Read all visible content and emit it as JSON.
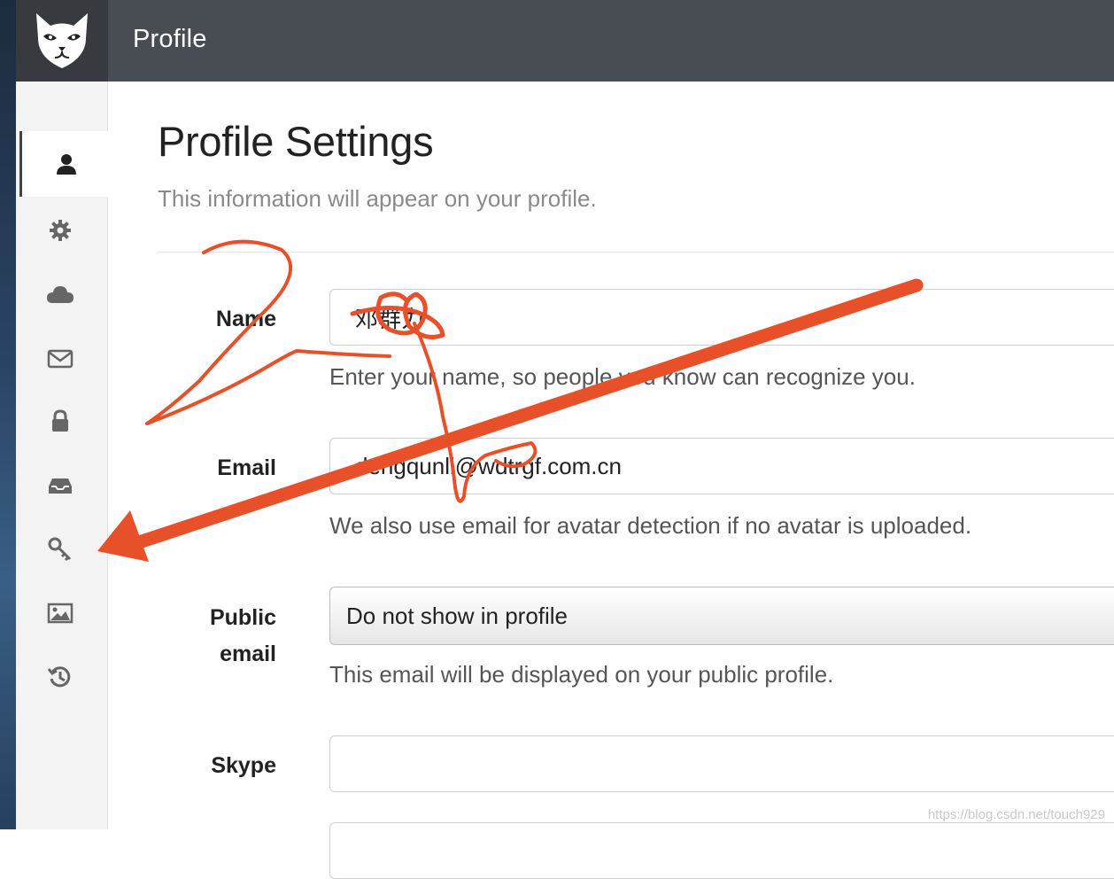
{
  "header": {
    "title": "Profile",
    "logo_icon": "cat-logo-icon",
    "bar_color": "#484c53"
  },
  "sidebar": {
    "items": [
      {
        "icon": "user-icon",
        "active": true
      },
      {
        "icon": "gear-icon",
        "active": false
      },
      {
        "icon": "cloud-icon",
        "active": false
      },
      {
        "icon": "envelope-icon",
        "active": false
      },
      {
        "icon": "lock-icon",
        "active": false
      },
      {
        "icon": "inbox-icon",
        "active": false
      },
      {
        "icon": "key-icon",
        "active": false
      },
      {
        "icon": "image-icon",
        "active": false
      },
      {
        "icon": "history-icon",
        "active": false
      }
    ]
  },
  "main": {
    "title": "Profile Settings",
    "subtitle": "This information will appear on your profile.",
    "fields": {
      "name": {
        "label": "Name",
        "value": "邓群力",
        "help": "Enter your name, so people you know can recognize you."
      },
      "email": {
        "label": "Email",
        "value": "dengqunli@wdtrgf.com.cn",
        "help": "We also use email for avatar detection if no avatar is uploaded."
      },
      "public_email": {
        "label_line1": "Public",
        "label_line2": "email",
        "value": "Do not show in profile",
        "help": "This email will be displayed on your public profile."
      },
      "skype": {
        "label": "Skype",
        "value": ""
      }
    }
  },
  "annotation": {
    "color": "#e8502a",
    "note": "red hand-drawn arrow pointing to key-icon"
  },
  "watermark": "https://blog.csdn.net/touch929"
}
